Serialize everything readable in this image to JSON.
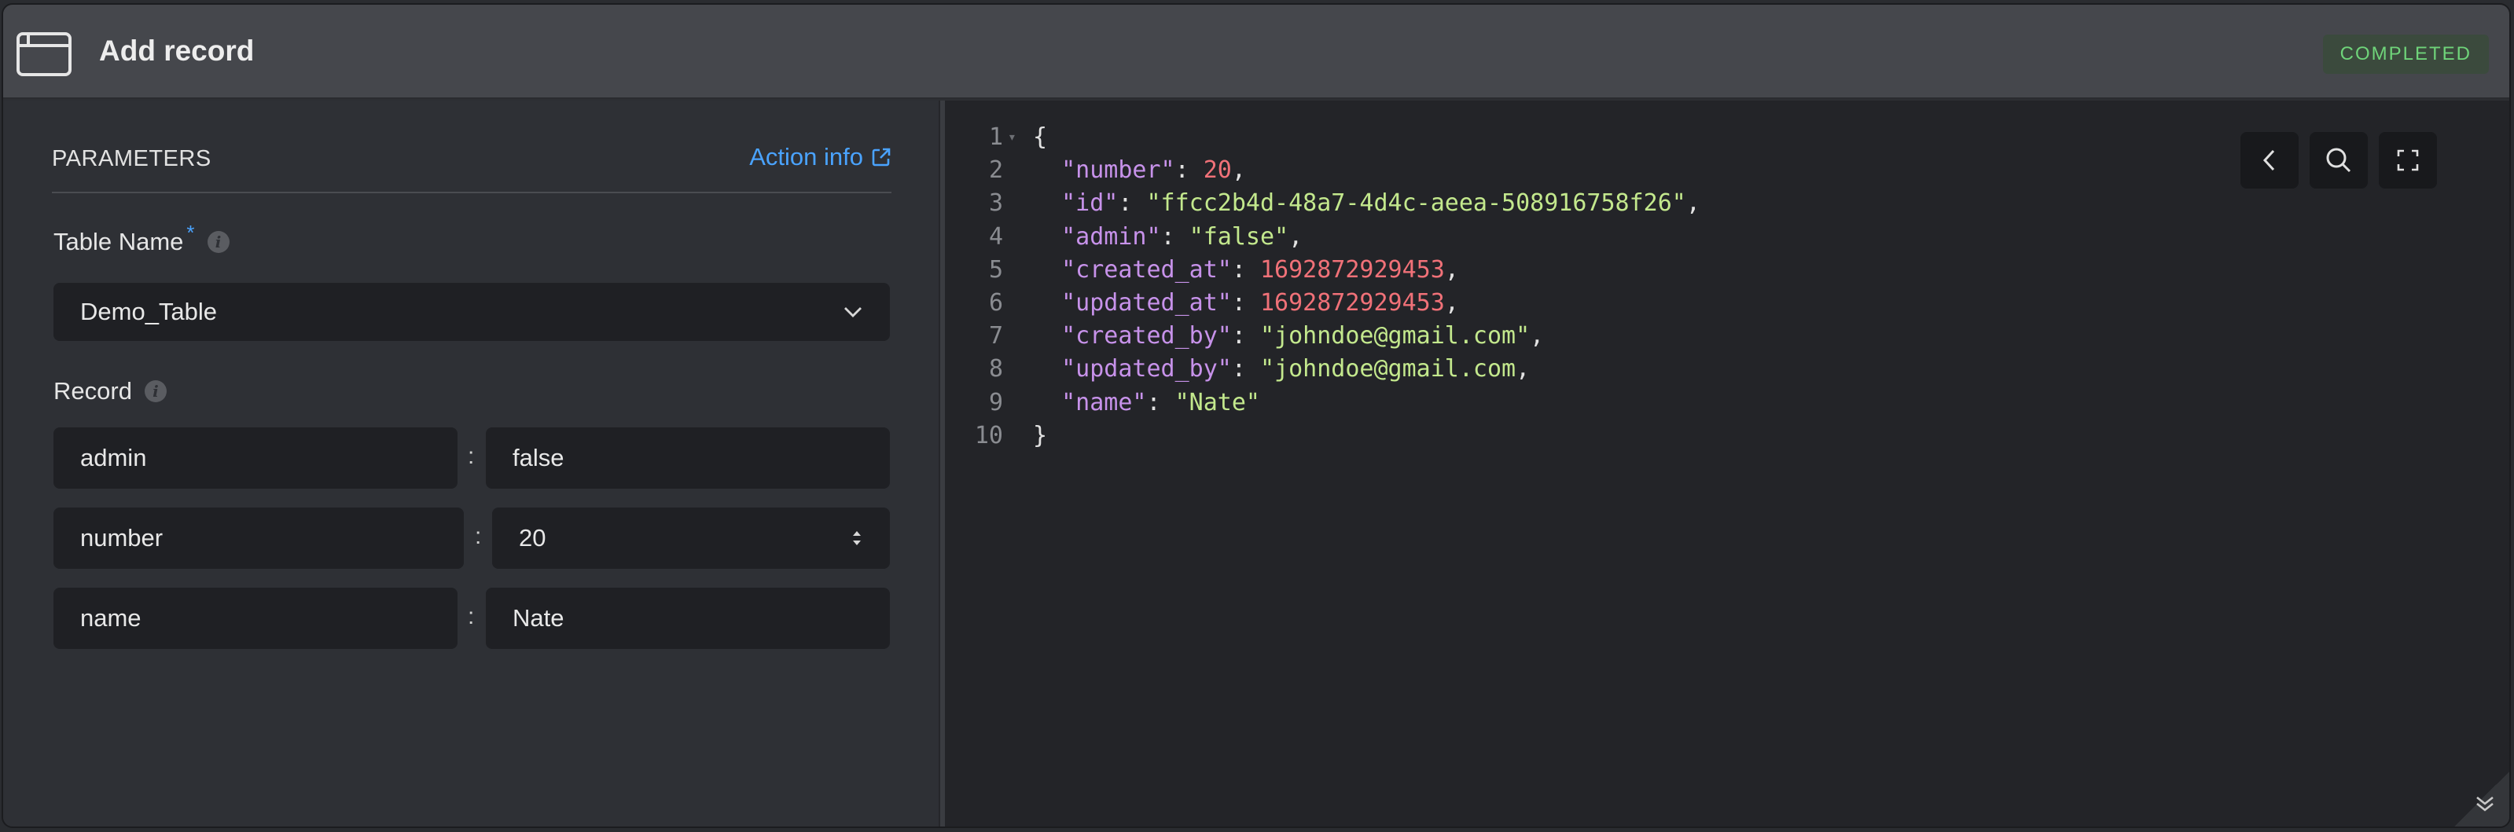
{
  "header": {
    "title": "Add record",
    "status": "COMPLETED",
    "icon": "window-icon"
  },
  "params": {
    "section_label": "PARAMETERS",
    "action_link": "Action info",
    "table_name": {
      "label": "Table Name",
      "required_mark": "*",
      "value": "Demo_Table"
    },
    "record": {
      "label": "Record",
      "rows": [
        {
          "key": "admin",
          "value": "false"
        },
        {
          "key": "number",
          "value": "20"
        },
        {
          "key": "name",
          "value": "Nate"
        }
      ]
    }
  },
  "code": {
    "lines": [
      {
        "no": "1",
        "parts": [
          {
            "t": "{",
            "c": "p"
          }
        ]
      },
      {
        "no": "2",
        "parts": [
          {
            "t": "  \"number\"",
            "c": "k"
          },
          {
            "t": ": ",
            "c": "p"
          },
          {
            "t": "20",
            "c": "n"
          },
          {
            "t": ",",
            "c": "p"
          }
        ]
      },
      {
        "no": "3",
        "parts": [
          {
            "t": "  \"id\"",
            "c": "k"
          },
          {
            "t": ": ",
            "c": "p"
          },
          {
            "t": "\"ffcc2b4d-48a7-4d4c-aeea-508916758f26\"",
            "c": "s"
          },
          {
            "t": ",",
            "c": "p"
          }
        ]
      },
      {
        "no": "4",
        "parts": [
          {
            "t": "  \"admin\"",
            "c": "k"
          },
          {
            "t": ": ",
            "c": "p"
          },
          {
            "t": "\"false\"",
            "c": "s"
          },
          {
            "t": ",",
            "c": "p"
          }
        ]
      },
      {
        "no": "5",
        "parts": [
          {
            "t": "  \"created_at\"",
            "c": "k"
          },
          {
            "t": ": ",
            "c": "p"
          },
          {
            "t": "1692872929453",
            "c": "n"
          },
          {
            "t": ",",
            "c": "p"
          }
        ]
      },
      {
        "no": "6",
        "parts": [
          {
            "t": "  \"updated_at\"",
            "c": "k"
          },
          {
            "t": ": ",
            "c": "p"
          },
          {
            "t": "1692872929453",
            "c": "n"
          },
          {
            "t": ",",
            "c": "p"
          }
        ]
      },
      {
        "no": "7",
        "parts": [
          {
            "t": "  \"created_by\"",
            "c": "k"
          },
          {
            "t": ": ",
            "c": "p"
          },
          {
            "t": "\"johndoe@gmail.com\"",
            "c": "s"
          },
          {
            "t": ",",
            "c": "p"
          }
        ]
      },
      {
        "no": "8",
        "parts": [
          {
            "t": "  \"updated_by\"",
            "c": "k"
          },
          {
            "t": ": ",
            "c": "p"
          },
          {
            "t": "\"johndoe@gmail.com",
            "c": "s"
          },
          {
            "t": ",",
            "c": "p"
          }
        ]
      },
      {
        "no": "9",
        "parts": [
          {
            "t": "  \"name\"",
            "c": "k"
          },
          {
            "t": ": ",
            "c": "p"
          },
          {
            "t": "\"Nate\"",
            "c": "s"
          }
        ]
      },
      {
        "no": "10",
        "parts": [
          {
            "t": "}",
            "c": "p"
          }
        ]
      }
    ]
  },
  "colors": {
    "accent": "#4aa3ff",
    "status_green": "#6fd47a",
    "json_key": "#c792ea",
    "json_string": "#c3e88d",
    "json_number": "#f07178"
  }
}
